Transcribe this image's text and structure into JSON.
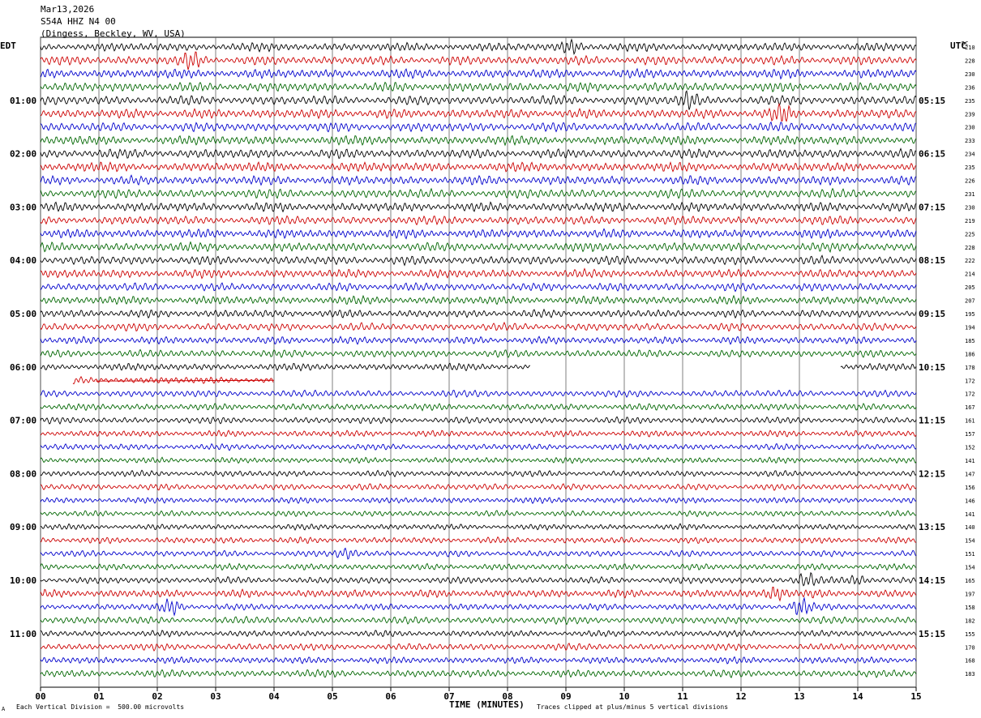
{
  "header": {
    "date": "Mar13,2026",
    "station": "S54A HHZ N4 00",
    "location": "(Dingess, Beckley, WV, USA)"
  },
  "left_timezone": "EDT",
  "right_timezone": "UTC",
  "dc_header": "DC",
  "footer": {
    "scale_note": "Each Vertical Division =  500.00 microvolts",
    "clip_note": "Traces clipped at plus/minus 5 vertical divisions",
    "corner_mark": "A"
  },
  "colors": {
    "black": "#000000",
    "red": "#cc0000",
    "blue": "#0000cc",
    "green": "#006600",
    "grid": "#606060"
  },
  "chart_data": {
    "type": "line",
    "chart_kind": "helicorder seismogram",
    "xlabel": "TIME (MINUTES)",
    "x_ticks": [
      "00",
      "01",
      "02",
      "03",
      "04",
      "05",
      "06",
      "07",
      "08",
      "09",
      "10",
      "11",
      "12",
      "13",
      "14",
      "15"
    ],
    "xlim": [
      0,
      15
    ],
    "minutes_per_line": 15,
    "trace_color_cycle": [
      "black",
      "red",
      "blue",
      "green"
    ],
    "left_hour_labels": [
      "01:00",
      "02:00",
      "03:00",
      "04:00",
      "05:00",
      "06:00",
      "07:00",
      "08:00",
      "09:00",
      "10:00",
      "11:00"
    ],
    "right_hour_labels": [
      "05:15",
      "06:15",
      "07:15",
      "08:15",
      "09:15",
      "10:15",
      "11:15",
      "12:15",
      "13:15",
      "14:15",
      "15:15"
    ],
    "dc_offsets": [
      210,
      228,
      230,
      236,
      235,
      239,
      230,
      233,
      234,
      235,
      226,
      231,
      230,
      219,
      225,
      228,
      222,
      214,
      205,
      207,
      195,
      194,
      185,
      186,
      178,
      172,
      172,
      167,
      161,
      157,
      152,
      141,
      147,
      156,
      146,
      141,
      140,
      154,
      151,
      154,
      165,
      197,
      158,
      182,
      155,
      170,
      168,
      183
    ],
    "gaps": [
      {
        "line": 24,
        "from_min": 8.4,
        "to_min": 13.7
      },
      {
        "line": 25,
        "from_min": 0.0,
        "to_min": 0.55
      },
      {
        "line": 25,
        "from_min": 4.0,
        "to_min": 15.0
      }
    ],
    "events": [
      {
        "line": 0,
        "at_min": 9.1,
        "amp": 1.6
      },
      {
        "line": 1,
        "at_min": 2.6,
        "amp": 1.5
      },
      {
        "line": 4,
        "at_min": 11.1,
        "amp": 1.6
      },
      {
        "line": 5,
        "at_min": 12.7,
        "amp": 1.4
      },
      {
        "line": 38,
        "at_min": 5.25,
        "amp": 1.8
      },
      {
        "line": 40,
        "at_min": 13.1,
        "amp": 1.8
      },
      {
        "line": 40,
        "at_min": 14.0,
        "amp": 1.8
      },
      {
        "line": 41,
        "at_min": 12.6,
        "amp": 2.6
      },
      {
        "line": 42,
        "at_min": 2.25,
        "amp": 2.4
      },
      {
        "line": 42,
        "at_min": 13.0,
        "amp": 3.0
      }
    ]
  }
}
